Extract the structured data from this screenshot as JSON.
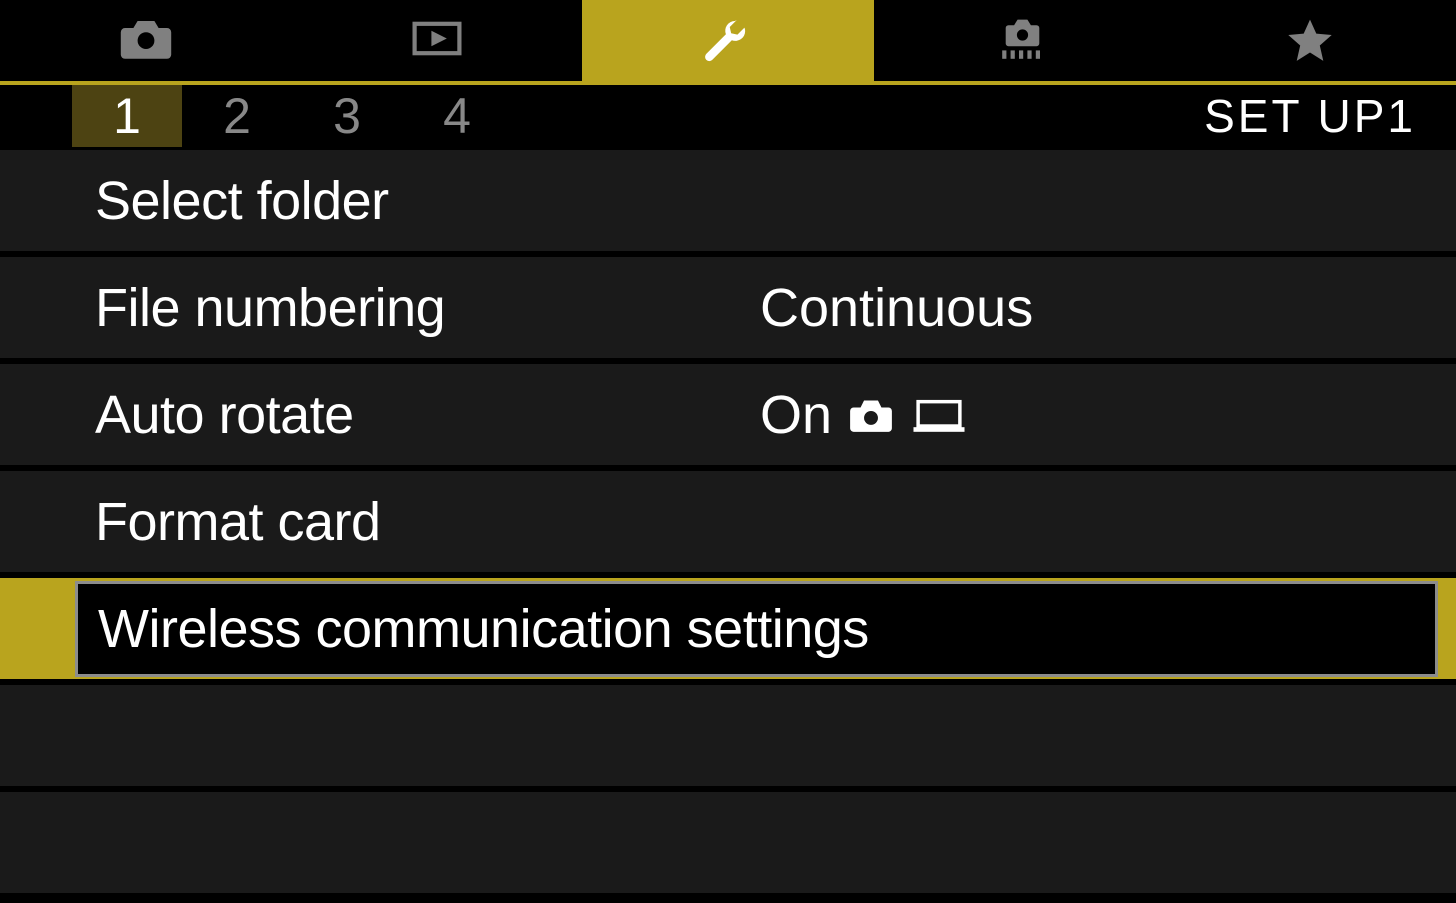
{
  "topTabs": [
    {
      "icon": "camera",
      "active": false
    },
    {
      "icon": "playback",
      "active": false
    },
    {
      "icon": "wrench",
      "active": true
    },
    {
      "icon": "custom-functions",
      "active": false
    },
    {
      "icon": "star",
      "active": false
    }
  ],
  "subTabs": [
    "1",
    "2",
    "3",
    "4"
  ],
  "activeSubTab": 0,
  "sectionLabel": "SET UP1",
  "menuItems": [
    {
      "label": "Select folder",
      "value": "",
      "selected": false
    },
    {
      "label": "File numbering",
      "value": "Continuous",
      "selected": false
    },
    {
      "label": "Auto rotate",
      "value": "On",
      "valueIcons": [
        "camera",
        "computer"
      ],
      "selected": false
    },
    {
      "label": "Format card",
      "value": "",
      "selected": false
    },
    {
      "label": "Wireless communication settings",
      "value": "",
      "selected": true
    },
    {
      "label": "",
      "value": "",
      "selected": false,
      "empty": true
    },
    {
      "label": "",
      "value": "",
      "selected": false,
      "empty": true
    }
  ]
}
